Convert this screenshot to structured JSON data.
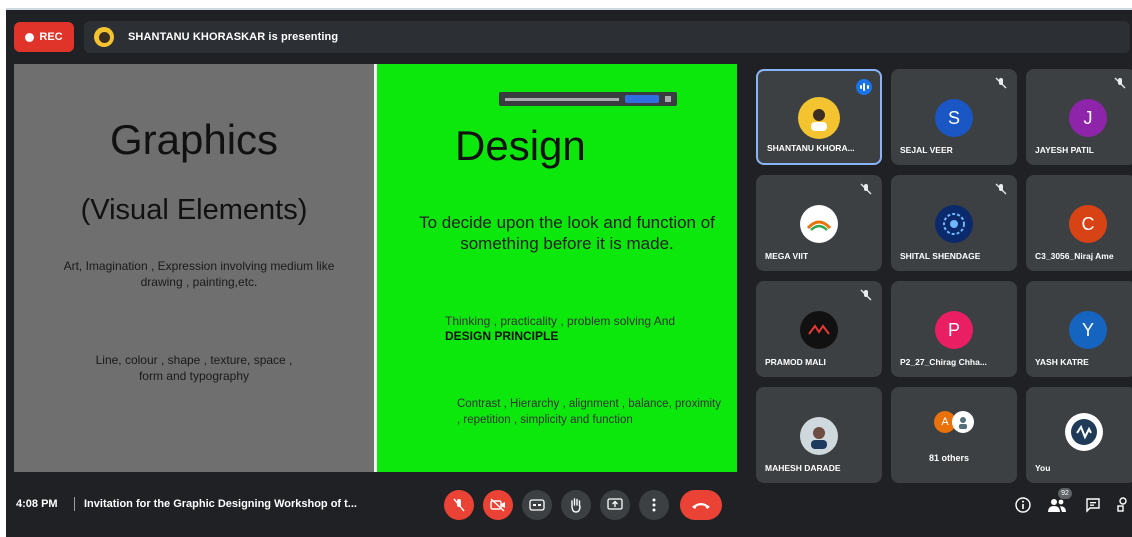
{
  "top_bar": {
    "rec_label": "REC",
    "presenting_text": "SHANTANU KHORASKAR is presenting"
  },
  "slide": {
    "left": {
      "title": "Graphics",
      "subtitle": "(Visual Elements)",
      "paragraph1": "Art, Imagination , Expression involving medium like drawing , painting,etc.",
      "paragraph2": "Line, colour , shape , texture, space , form and typography"
    },
    "right": {
      "title": "Design",
      "paragraph1": "To decide upon the look and function of something before it is made.",
      "paragraph2_plain": "Thinking , practicality , problem solving And",
      "paragraph2_bold": "DESIGN PRINCIPLE",
      "paragraph3": "Contrast , Hierarchy , alignment , balance, proximity , repetition , simplicity and function"
    },
    "background_left": "#6f6f70",
    "background_right": "#0ce80c"
  },
  "participants": [
    {
      "name": "SHANTANU KHORA...",
      "initial": "",
      "color": "#f4c430",
      "status": "speaking"
    },
    {
      "name": "SEJAL VEER",
      "initial": "S",
      "color": "#1a56c4",
      "status": "muted"
    },
    {
      "name": "JAYESH PATIL",
      "initial": "J",
      "color": "#8e24aa",
      "status": "muted"
    },
    {
      "name": "MEGA VIIT",
      "initial": "",
      "color": "#ffffff",
      "status": "muted"
    },
    {
      "name": "SHITAL SHENDAGE",
      "initial": "",
      "color": "#0b2a6b",
      "status": "muted"
    },
    {
      "name": "C3_3056_Niraj Ame",
      "initial": "C",
      "color": "#d84315",
      "status": "none"
    },
    {
      "name": "PRAMOD MALI",
      "initial": "",
      "color": "#111111",
      "status": "muted"
    },
    {
      "name": "P2_27_Chirag Chha...",
      "initial": "P",
      "color": "#e91e63",
      "status": "none"
    },
    {
      "name": "YASH KATRE",
      "initial": "Y",
      "color": "#1565c0",
      "status": "none"
    },
    {
      "name": "MAHESH DARADE",
      "initial": "",
      "color": "#cfd8dc",
      "status": "none"
    },
    {
      "name": "81 others",
      "initial": "A",
      "color": "#e8710a",
      "status": "none"
    },
    {
      "name": "You",
      "initial": "",
      "color": "#ffffff",
      "status": "none"
    }
  ],
  "bottom_bar": {
    "time": "4:08 PM",
    "meeting_title": "Invitation for the Graphic Designing Workshop of t...",
    "people_count": "92"
  }
}
